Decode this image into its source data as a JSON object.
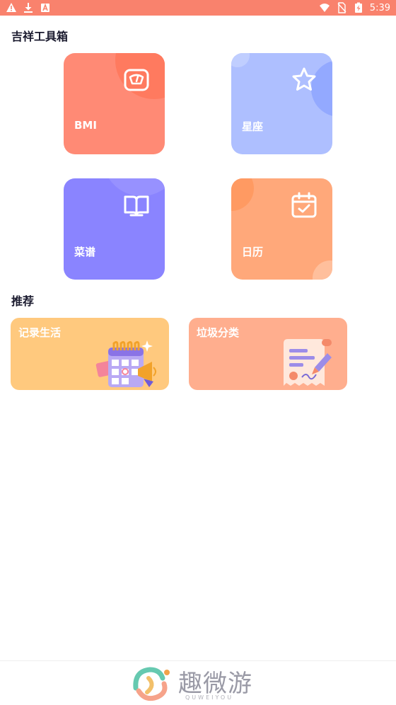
{
  "status_bar": {
    "time": "5:39",
    "icons": [
      "warning-icon",
      "download-icon",
      "app-notification-icon",
      "wifi-icon",
      "no-sim-icon",
      "battery-charging-icon"
    ]
  },
  "colors": {
    "status_bar": "#f9826d",
    "bmi_tile": "#ff8a75",
    "constellation_tile": "#aebfff",
    "recipe_tile": "#8a84ff",
    "calendar_tile": "#ffa87a",
    "record_card": "#ffc97e",
    "trash_card": "#ffae8e"
  },
  "toolbox": {
    "title": "吉祥工具箱",
    "tiles": [
      {
        "label": "BMI",
        "icon": "scale-icon"
      },
      {
        "label": "星座",
        "icon": "star-icon"
      },
      {
        "label": "菜谱",
        "icon": "book-icon"
      },
      {
        "label": "日历",
        "icon": "calendar-icon"
      }
    ]
  },
  "recommend": {
    "title": "推荐",
    "cards": [
      {
        "label": "记录生活",
        "icon": "calendar-megaphone-illustration"
      },
      {
        "label": "垃圾分类",
        "icon": "document-signing-illustration"
      }
    ]
  },
  "watermark": {
    "text": "趣微游",
    "sub": "QUWEIYOU"
  }
}
